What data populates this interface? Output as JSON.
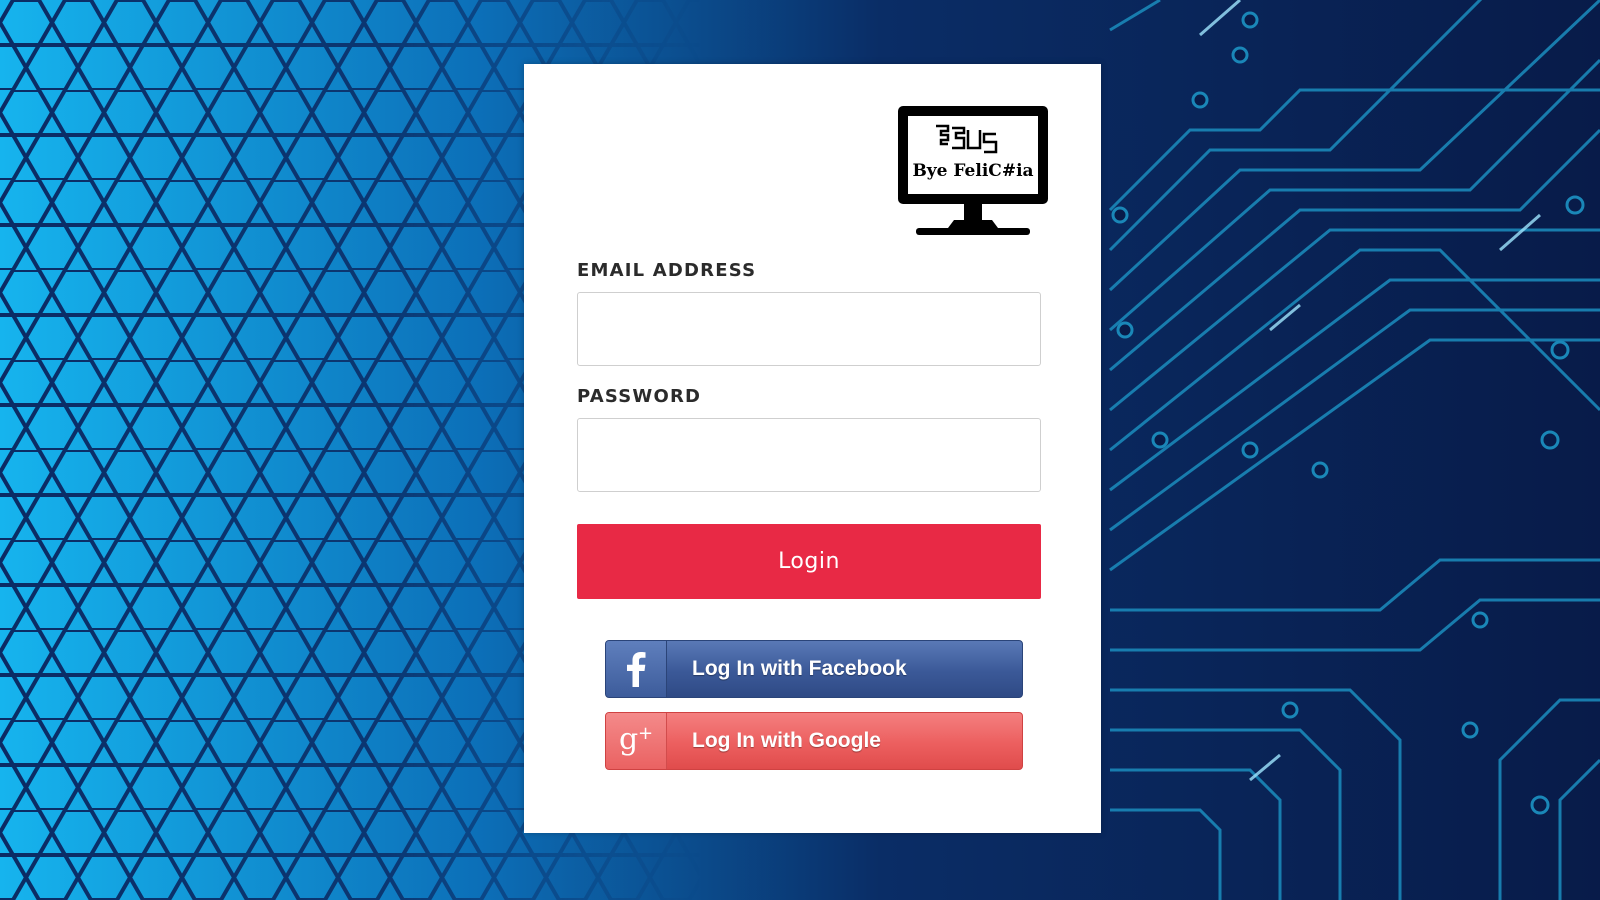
{
  "logo": {
    "mark_text": "ESUS",
    "caption": "Bye FeliC#ia"
  },
  "form": {
    "email_label": "EMAIL ADDRESS",
    "email_value": "",
    "password_label": "PASSWORD",
    "password_value": "",
    "login_label": "Login"
  },
  "social": {
    "facebook_label": "Log In with Facebook",
    "google_label": "Log In with Google"
  },
  "colors": {
    "login_button": "#e82945",
    "facebook": "#3b5998",
    "google": "#ec5f5f",
    "background_left": "#17b8f0",
    "background_right": "#0a1c48"
  },
  "icons": {
    "facebook": "facebook-f-icon",
    "google": "google-plus-icon",
    "logo": "monitor-logo-icon"
  }
}
